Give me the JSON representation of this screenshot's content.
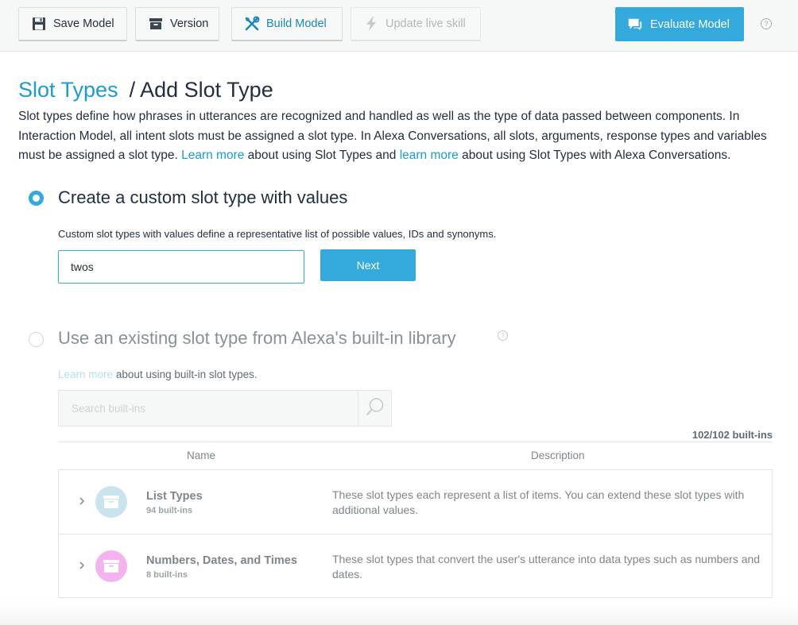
{
  "toolbar": {
    "save_model": "Save Model",
    "version": "Version",
    "build_model": "Build Model",
    "update_live_skill": "Update live skill",
    "evaluate_model": "Evaluate Model",
    "help": "?"
  },
  "breadcrumb": {
    "parent": "Slot Types",
    "separator": "/",
    "current": "Add Slot Type"
  },
  "intro": {
    "text1": "Slot types define how phrases in utterances are recognized and handled as well as the type of data passed between components. In Interaction Model, all intent slots must be assigned a slot type. In Alexa Conversations, all slots, arguments, response types and variables must be assigned a slot type.",
    "link1": "Learn more",
    "text2": "about using Slot Types and",
    "link2": "learn more",
    "text3": "about using Slot Types with Alexa Conversations."
  },
  "custom_option": {
    "title": "Create a custom slot type with values",
    "description": "Custom slot types with values define a representative list of possible values, IDs and synonyms.",
    "input_value": "twos",
    "next_label": "Next",
    "selected": true
  },
  "builtin_option": {
    "title": "Use an existing slot type from Alexa's built-in library",
    "help": "?",
    "learn_more": "Learn more",
    "learn_more_suffix": "about using built-in slot types.",
    "search_placeholder": "Search built-ins",
    "count": "102/102 built-ins",
    "col_name": "Name",
    "col_description": "Description",
    "rows": [
      {
        "title": "List Types",
        "subtitle": "94 built-ins",
        "description": "These slot types each represent a list of items. You can extend these slot types with additional values.",
        "color": "#c9e4ec",
        "icon": "list-box-icon"
      },
      {
        "title": "Numbers, Dates, and Times",
        "subtitle": "8 built-ins",
        "description": "These slot types that convert the user's utterance into data types such as numbers and dates.",
        "color": "#f4b3ef",
        "icon": "calendar-box-icon"
      }
    ]
  },
  "colors": {
    "accent": "#34aadc",
    "link": "#1a9bd4",
    "text": "#232f3e"
  }
}
